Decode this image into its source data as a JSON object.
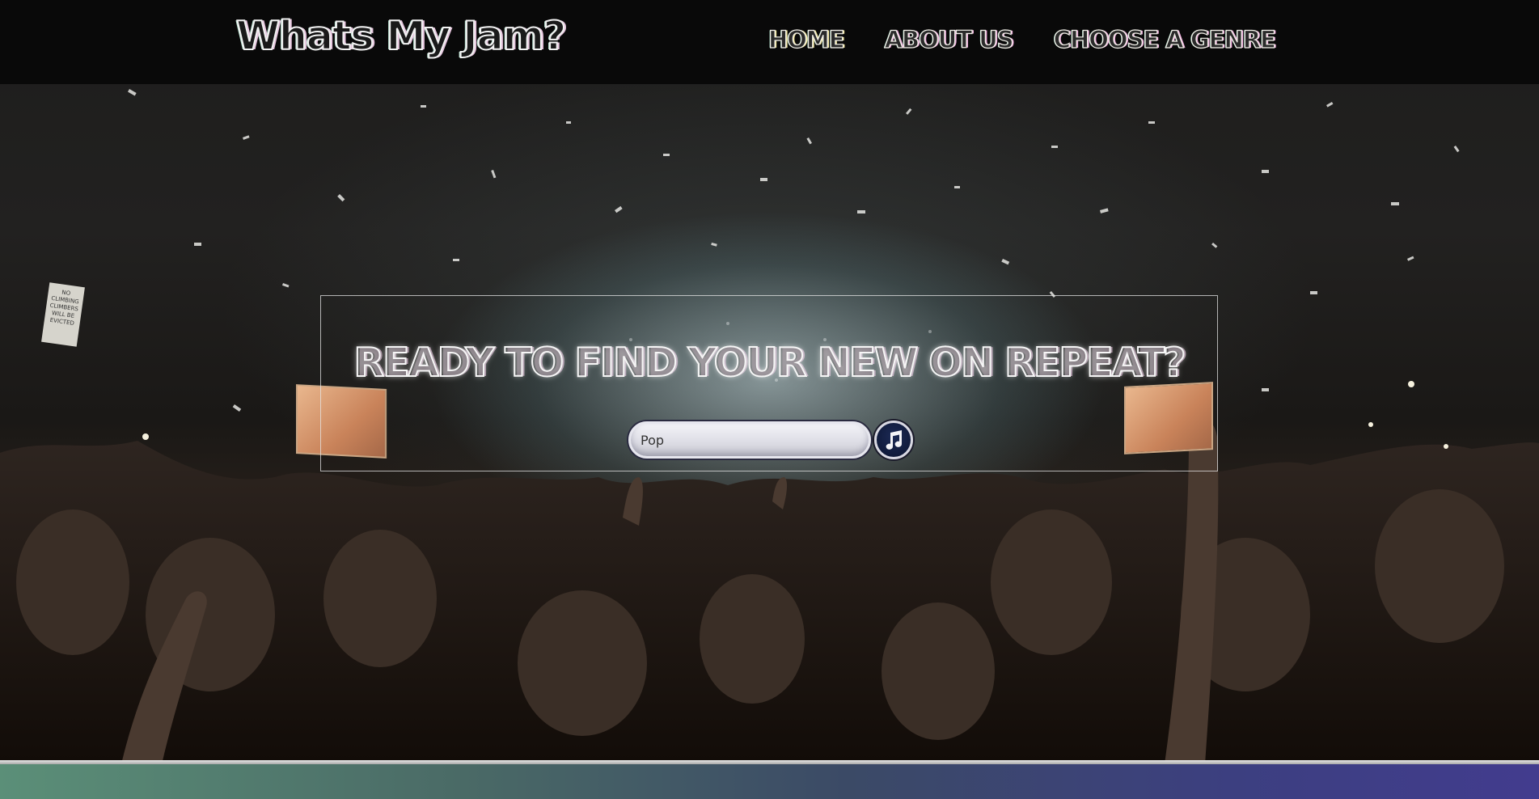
{
  "header": {
    "logo": "Whats My Jam?",
    "nav": [
      {
        "label": "HOME"
      },
      {
        "label": "ABOUT US"
      },
      {
        "label": "CHOOSE A GENRE"
      }
    ]
  },
  "hero": {
    "headline": "READY TO FIND YOUR NEW ON REPEAT?",
    "search": {
      "value": "Pop",
      "placeholder": "Pop"
    },
    "submit_icon": "music-note-icon",
    "background_image": "concert-crowd-confetti",
    "sign_text": "NO CLIMBING CLIMBERS WILL BE EVICTED"
  },
  "colors": {
    "header_bg": "#080808",
    "button_bg": "#0b1431",
    "band_start": "#5b8f78",
    "band_end": "#423c8e"
  }
}
